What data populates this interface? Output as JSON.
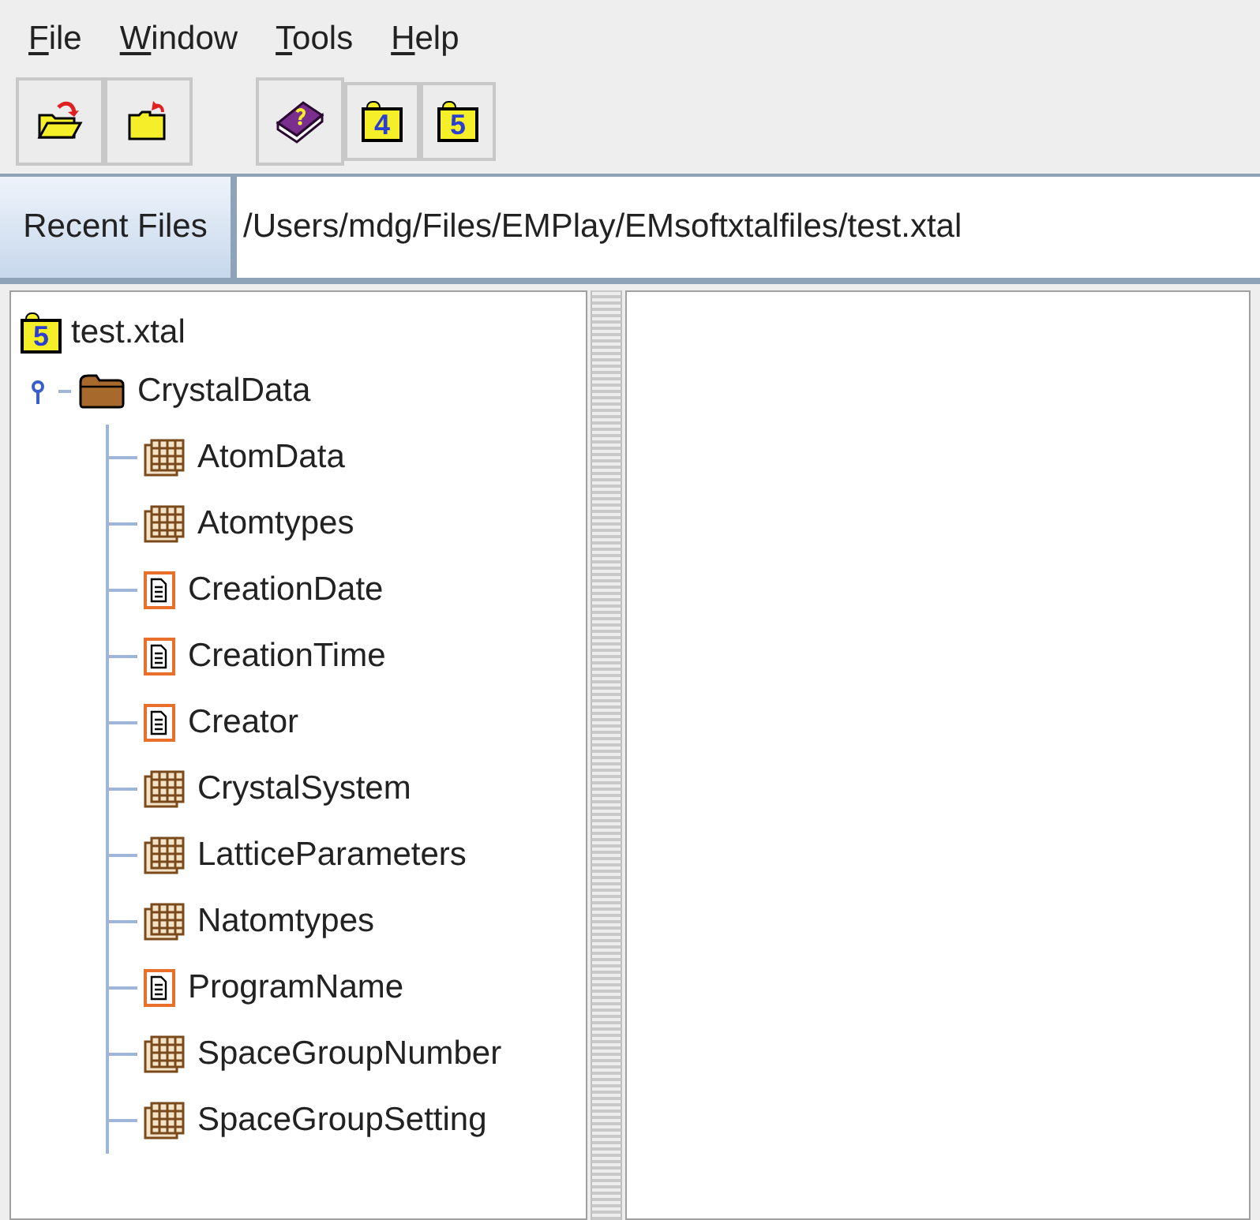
{
  "menu": [
    "File",
    "Window",
    "Tools",
    "Help"
  ],
  "toolbar": [
    {
      "kind": "open"
    },
    {
      "kind": "close"
    },
    {
      "kind": "help"
    },
    {
      "kind": "hdf4",
      "label": "4"
    },
    {
      "kind": "hdf5",
      "label": "5"
    }
  ],
  "recent_files": {
    "label": "Recent Files",
    "value": "/Users/mdg/Files/EMPlay/EMsoftxtalfiles/test.xtal"
  },
  "tree": {
    "label": "test.xtal",
    "icon_label": "5",
    "children": [
      {
        "label": "CrystalData",
        "kind": "group",
        "expanded": true,
        "children": [
          {
            "label": "AtomData",
            "kind": "dataset"
          },
          {
            "label": "Atomtypes",
            "kind": "dataset"
          },
          {
            "label": "CreationDate",
            "kind": "text"
          },
          {
            "label": "CreationTime",
            "kind": "text"
          },
          {
            "label": "Creator",
            "kind": "text"
          },
          {
            "label": "CrystalSystem",
            "kind": "dataset"
          },
          {
            "label": "LatticeParameters",
            "kind": "dataset"
          },
          {
            "label": "Natomtypes",
            "kind": "dataset"
          },
          {
            "label": "ProgramName",
            "kind": "text"
          },
          {
            "label": "SpaceGroupNumber",
            "kind": "dataset"
          },
          {
            "label": "SpaceGroupSetting",
            "kind": "dataset"
          }
        ]
      }
    ]
  }
}
